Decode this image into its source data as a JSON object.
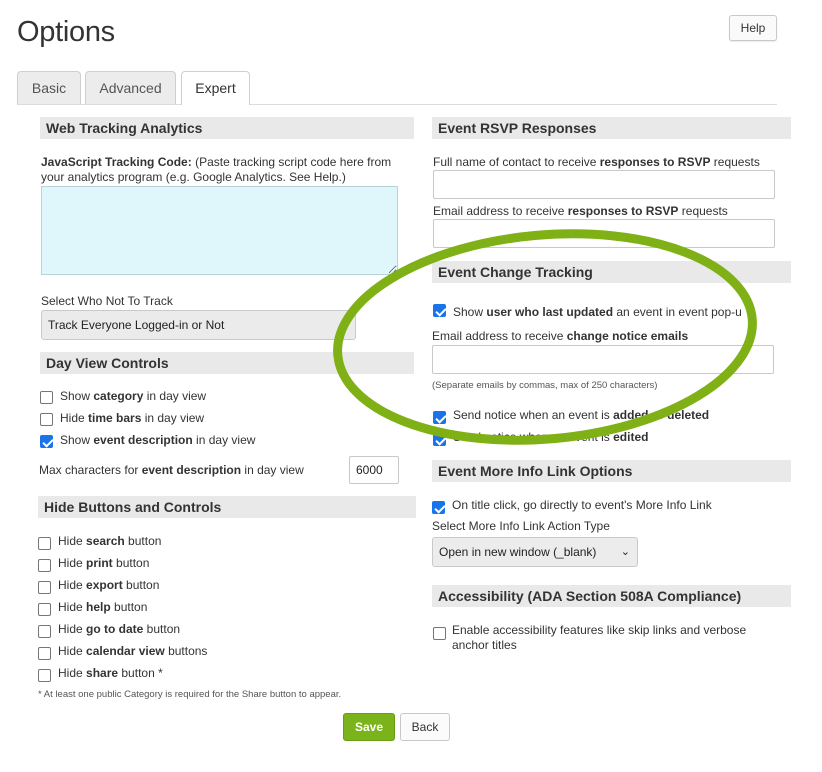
{
  "page": {
    "title": "Options",
    "help_label": "Help"
  },
  "tabs": [
    {
      "label": "Basic"
    },
    {
      "label": "Advanced"
    },
    {
      "label": "Expert"
    }
  ],
  "left": {
    "web_tracking": {
      "heading": "Web Tracking Analytics",
      "code_label_bold": "JavaScript Tracking Code:",
      "code_label_rest": " (Paste tracking script code here from your analytics program (e.g. Google Analytics. See Help.)",
      "code_value": "",
      "not_track_label": "Select Who Not To Track",
      "not_track_value": "Track Everyone Logged-in or Not"
    },
    "day_view": {
      "heading": "Day View Controls",
      "options": [
        {
          "pre": "Show ",
          "bold": "category",
          "post": " in day view",
          "checked": false
        },
        {
          "pre": "Hide ",
          "bold": "time bars",
          "post": " in day view",
          "checked": false
        },
        {
          "pre": "Show ",
          "bold": "event description",
          "post": " in day view",
          "checked": true
        }
      ],
      "max_chars": {
        "pre": "Max characters for ",
        "bold": "event description",
        "post": " in day view",
        "value": "6000"
      }
    },
    "hide_buttons": {
      "heading": "Hide Buttons and Controls",
      "options": [
        {
          "pre": "Hide ",
          "bold": "search",
          "post": " button",
          "checked": false
        },
        {
          "pre": "Hide ",
          "bold": "print",
          "post": " button",
          "checked": false
        },
        {
          "pre": "Hide ",
          "bold": "export",
          "post": " button",
          "checked": false
        },
        {
          "pre": "Hide ",
          "bold": "help",
          "post": " button",
          "checked": false
        },
        {
          "pre": "Hide ",
          "bold": "go to date",
          "post": " button",
          "checked": false
        },
        {
          "pre": "Hide ",
          "bold": "calendar view",
          "post": " buttons",
          "checked": false
        },
        {
          "pre": "Hide ",
          "bold": "share",
          "post": " button *",
          "checked": false
        }
      ],
      "footnote": "* At least one public Category is required for the Share button to appear."
    }
  },
  "right": {
    "rsvp": {
      "heading": "Event RSVP Responses",
      "name_label_pre": "Full name of contact to receive ",
      "name_label_bold": "responses to RSVP",
      "name_label_post": " requests",
      "name_value": "",
      "email_label_pre": "Email address to receive ",
      "email_label_bold": "responses to RSVP",
      "email_label_post": " requests",
      "email_value": ""
    },
    "change_tracking": {
      "heading": "Event Change Tracking",
      "show_user": {
        "pre": "Show ",
        "bold": "user who last updated",
        "post": " an event in event pop-u",
        "checked": true
      },
      "email_label_pre": "Email address to receive ",
      "email_label_bold": "change notice emails",
      "email_value": "",
      "email_hint": "(Separate emails by commas, max of 250 characters)",
      "notices": [
        {
          "pre": "Send notice when an event is ",
          "bold": "added or deleted",
          "checked": true
        },
        {
          "pre": "Send notice when an event is ",
          "bold": "edited",
          "checked": true
        }
      ]
    },
    "more_info": {
      "heading": "Event More Info Link Options",
      "direct_label": "On title click, go directly to event's More Info Link",
      "direct_checked": true,
      "action_label": "Select More Info Link Action Type",
      "action_value": "Open in new window (_blank)"
    },
    "accessibility": {
      "heading": "Accessibility (ADA Section 508A Compliance)",
      "label": "Enable accessibility features like skip links and verbose anchor titles",
      "checked": false
    }
  },
  "actions": {
    "save_label": "Save",
    "back_label": "Back"
  },
  "colors": {
    "highlight_ellipse": "#7fb015",
    "save_button": "#7bb31a",
    "checkbox_checked": "#1a73e8",
    "textarea_bg": "#dff6fb"
  }
}
